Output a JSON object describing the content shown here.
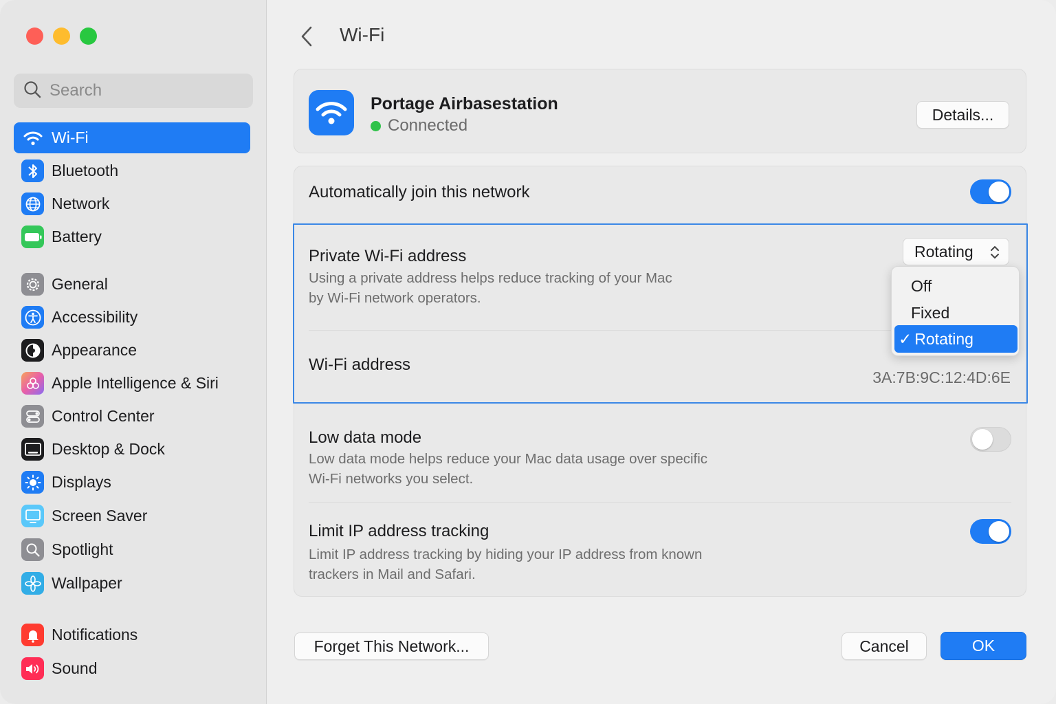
{
  "window": {
    "title": "Wi-Fi"
  },
  "search": {
    "placeholder": "Search"
  },
  "sidebar": {
    "items": [
      {
        "label": "Wi-Fi",
        "icon": "wifi-icon",
        "active": true
      },
      {
        "label": "Bluetooth",
        "icon": "bluetooth-icon"
      },
      {
        "label": "Network",
        "icon": "globe-icon"
      },
      {
        "label": "Battery",
        "icon": "battery-icon"
      },
      {
        "label": "General",
        "icon": "gear-icon"
      },
      {
        "label": "Accessibility",
        "icon": "accessibility-icon"
      },
      {
        "label": "Appearance",
        "icon": "appearance-icon"
      },
      {
        "label": "Apple Intelligence & Siri",
        "icon": "siri-icon"
      },
      {
        "label": "Control Center",
        "icon": "control-center-icon"
      },
      {
        "label": "Desktop & Dock",
        "icon": "desktop-dock-icon"
      },
      {
        "label": "Displays",
        "icon": "sun-icon"
      },
      {
        "label": "Screen Saver",
        "icon": "screen-saver-icon"
      },
      {
        "label": "Spotlight",
        "icon": "magnifier-icon"
      },
      {
        "label": "Wallpaper",
        "icon": "flower-icon"
      },
      {
        "label": "Notifications",
        "icon": "bell-icon"
      },
      {
        "label": "Sound",
        "icon": "speaker-icon"
      }
    ]
  },
  "network": {
    "name": "Portage Airbasestation",
    "status": "Connected",
    "details_label": "Details..."
  },
  "settings": {
    "auto_join": {
      "label": "Automatically join this network",
      "enabled": true
    },
    "private_address": {
      "label": "Private Wi-Fi address",
      "description_line1": "Using a private address helps reduce tracking of your Mac",
      "description_line2": "by Wi-Fi network operators.",
      "selected": "Rotating",
      "options": [
        "Off",
        "Fixed",
        "Rotating"
      ],
      "check": "✓"
    },
    "wifi_address": {
      "label": "Wi-Fi address",
      "value": "3A:7B:9C:12:4D:6E"
    },
    "low_data": {
      "label": "Low data mode",
      "description_line1": "Low data mode helps reduce your Mac data usage over specific",
      "description_line2": "Wi-Fi networks you select.",
      "enabled": false
    },
    "limit_ip": {
      "label": "Limit IP address tracking",
      "description_line1": "Limit IP address tracking by hiding your IP address from known",
      "description_line2": "trackers in Mail and Safari.",
      "enabled": true
    }
  },
  "footer": {
    "forget_label": "Forget This Network...",
    "cancel_label": "Cancel",
    "ok_label": "OK"
  },
  "colors": {
    "accent": "#1f7cf4",
    "connected": "#30c24a"
  }
}
